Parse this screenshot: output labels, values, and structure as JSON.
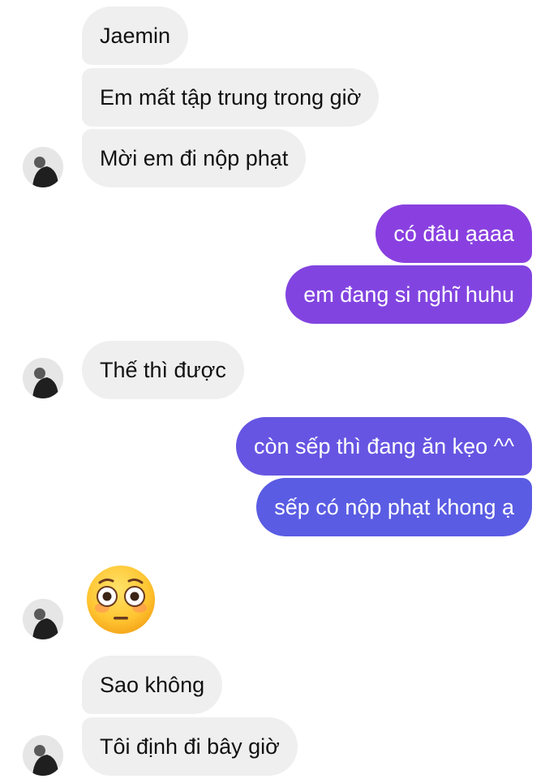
{
  "messages": [
    {
      "id": "m1",
      "text": "Jaemin"
    },
    {
      "id": "m2",
      "text": "Em mất tập trung trong giờ"
    },
    {
      "id": "m3",
      "text": "Mời em đi nộp phạt"
    },
    {
      "id": "m4",
      "text": "có đâu ạaaa"
    },
    {
      "id": "m5",
      "text": "em đang si nghĩ huhu"
    },
    {
      "id": "m6",
      "text": "Thế thì được"
    },
    {
      "id": "m7",
      "text": "còn sếp thì đang ăn kẹo ^^"
    },
    {
      "id": "m8",
      "text": "sếp có nộp phạt khong ạ"
    },
    {
      "id": "m9",
      "emoji": "flushed-face-icon"
    },
    {
      "id": "m10",
      "text": "Sao không"
    },
    {
      "id": "m11",
      "text": "Tôi định đi bây giờ"
    }
  ],
  "colors": {
    "incoming_bubble": "#efeff0",
    "incoming_text": "#111111",
    "outgoing_text": "#ffffff",
    "outgoing_gradient_top": "#8a3fe0",
    "outgoing_gradient_bottom": "#5a5ce3"
  }
}
